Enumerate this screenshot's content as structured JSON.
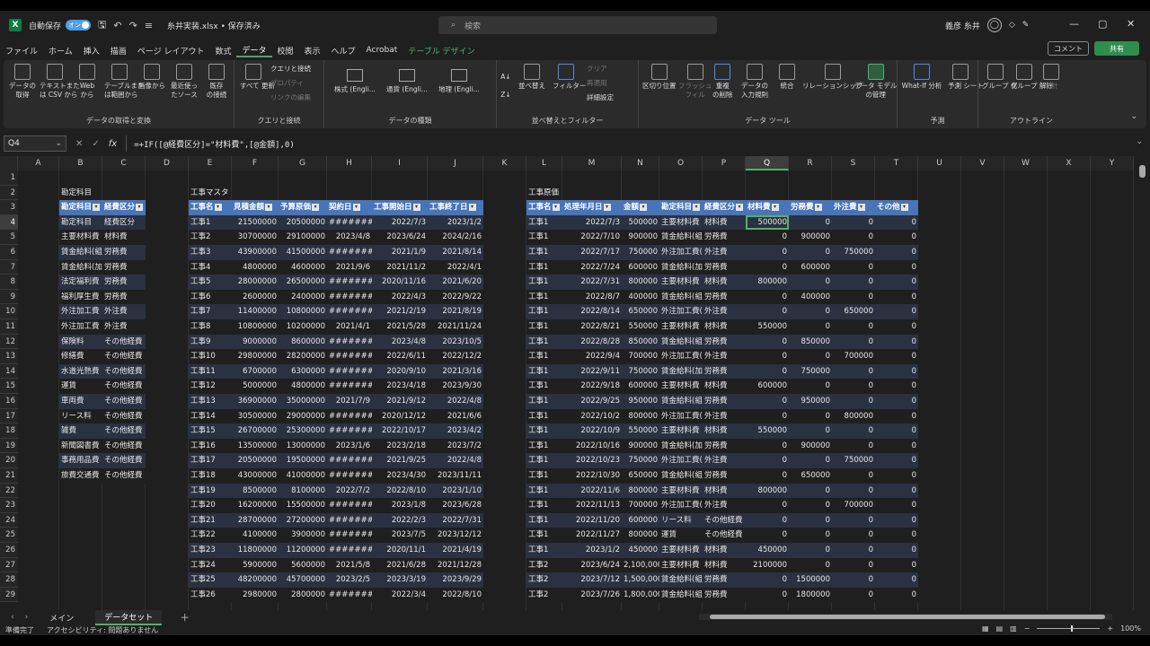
{
  "window": {
    "autosave_label": "自動保存",
    "autosave_state": "オン",
    "filename": "糸井実装.xlsx • 保存済み",
    "search_placeholder": "検索",
    "user_name": "義彦 糸井"
  },
  "menu": [
    "ファイル",
    "ホーム",
    "挿入",
    "描画",
    "ページ レイアウト",
    "数式",
    "データ",
    "校閲",
    "表示",
    "ヘルプ",
    "Acrobat",
    "テーブル デザイン"
  ],
  "menu_active": "データ",
  "comment_btn": "コメント",
  "share_btn": "共有",
  "ribbon": {
    "get_data": {
      "label": "データの取得と変換",
      "buttons": [
        "データの\n取得",
        "テキストまた\nは CSV から",
        "Web\nから",
        "テーブルまた\nは範囲から",
        "画像から",
        "最近使っ\nたソース",
        "既存\nの接続"
      ]
    },
    "queries": {
      "label": "クエリと接続",
      "refresh": "すべて\n更新",
      "items": [
        "クエリと接続",
        "プロパティ",
        "リンクの編集"
      ]
    },
    "data_types": {
      "label": "データの種類",
      "items": [
        "株式 (Engli...",
        "通貨 (Engli...",
        "地理 (Engli..."
      ]
    },
    "sort_filter": {
      "label": "並べ替えとフィルター",
      "sort": "並べ替え",
      "filter": "フィルター",
      "items": [
        "クリア",
        "再適用",
        "詳細設定"
      ]
    },
    "data_tools": {
      "label": "データ ツール",
      "buttons": [
        "区切り位置",
        "フラッシュ\nフィル",
        "重複\nの削除",
        "データの\n入力規則",
        "統合",
        "リレーションシップ",
        "データ モデル\nの管理"
      ]
    },
    "forecast": {
      "label": "予測",
      "buttons": [
        "What-If 分析",
        "予測\nシート"
      ]
    },
    "outline": {
      "label": "アウトライン",
      "buttons": [
        "グループ\n化",
        "グループ\n解除",
        "小計"
      ]
    }
  },
  "namebox": "Q4",
  "formula": "=+IF([@経費区分]=\"材料費\",[@金額],0)",
  "columns": [
    "A",
    "B",
    "C",
    "D",
    "E",
    "F",
    "G",
    "H",
    "I",
    "J",
    "K",
    "L",
    "M",
    "N",
    "O",
    "P",
    "Q",
    "R",
    "S",
    "T",
    "U",
    "V",
    "W",
    "X",
    "Y"
  ],
  "selected_column": "Q",
  "rows": [
    "1",
    "2",
    "3",
    "4",
    "5",
    "6",
    "7",
    "8",
    "9",
    "10",
    "11",
    "12",
    "13",
    "14",
    "15",
    "16",
    "17",
    "18",
    "19",
    "20",
    "21",
    "22",
    "23",
    "24",
    "25",
    "26",
    "27",
    "28",
    "29"
  ],
  "selected_row": "4",
  "table1": {
    "title": "勘定科目",
    "headers": [
      "勘定科目",
      "経費区分"
    ],
    "rows": [
      [
        "勘定科目",
        "経費区分"
      ],
      [
        "主要材料費",
        "材料費"
      ],
      [
        "賃金給料(組",
        "労務費"
      ],
      [
        "賃金給料(加",
        "労務費"
      ],
      [
        "法定福利費",
        "労務費"
      ],
      [
        "福利厚生費",
        "労務費"
      ],
      [
        "外注加工費",
        "外注費"
      ],
      [
        "外注加工費",
        "外注費"
      ],
      [
        "保険料",
        "その他経費"
      ],
      [
        "修繕費",
        "その他経費"
      ],
      [
        "水道光熱費",
        "その他経費"
      ],
      [
        "運賃",
        "その他経費"
      ],
      [
        "車両費",
        "その他経費"
      ],
      [
        "リース料",
        "その他経費"
      ],
      [
        "雑費",
        "その他経費"
      ],
      [
        "新聞図書費",
        "その他経費"
      ],
      [
        "事務用品費",
        "その他経費"
      ],
      [
        "旅費交通費",
        "その他経費"
      ]
    ]
  },
  "table2": {
    "title": "工事マスタ",
    "headers": [
      "工事名",
      "見積金額",
      "予算原価",
      "契約日",
      "工事開始日",
      "工事終了日"
    ],
    "rows": [
      [
        "工事1",
        "21500000",
        "20500000",
        "#######",
        "2022/7/3",
        "2023/1/2"
      ],
      [
        "工事2",
        "30700000",
        "29100000",
        "2023/4/8",
        "2023/6/24",
        "2024/2/16"
      ],
      [
        "工事3",
        "43900000",
        "41500000",
        "#######",
        "2021/1/9",
        "2021/8/14"
      ],
      [
        "工事4",
        "4800000",
        "4600000",
        "2021/9/6",
        "2021/11/2",
        "2022/4/1"
      ],
      [
        "工事5",
        "28000000",
        "26500000",
        "#######",
        "2020/11/16",
        "2021/6/20"
      ],
      [
        "工事6",
        "2600000",
        "2400000",
        "#######",
        "2022/4/3",
        "2022/9/22"
      ],
      [
        "工事7",
        "11400000",
        "10800000",
        "#######",
        "2021/2/19",
        "2021/8/19"
      ],
      [
        "工事8",
        "10800000",
        "10200000",
        "2021/4/1",
        "2021/5/28",
        "2021/11/24"
      ],
      [
        "工事9",
        "9000000",
        "8600000",
        "#######",
        "2023/4/8",
        "2023/10/5"
      ],
      [
        "工事10",
        "29800000",
        "28200000",
        "#######",
        "2022/6/11",
        "2022/12/2"
      ],
      [
        "工事11",
        "6700000",
        "6300000",
        "#######",
        "2020/9/10",
        "2021/3/16"
      ],
      [
        "工事12",
        "5000000",
        "4800000",
        "#######",
        "2023/4/18",
        "2023/9/30"
      ],
      [
        "工事13",
        "36900000",
        "35000000",
        "2021/7/9",
        "2021/9/12",
        "2022/4/8"
      ],
      [
        "工事14",
        "30500000",
        "29000000",
        "#######",
        "2020/12/12",
        "2021/6/6"
      ],
      [
        "工事15",
        "26700000",
        "25300000",
        "#######",
        "2022/10/17",
        "2023/4/2"
      ],
      [
        "工事16",
        "13500000",
        "13000000",
        "2023/1/6",
        "2023/2/18",
        "2023/7/2"
      ],
      [
        "工事17",
        "20500000",
        "19500000",
        "#######",
        "2021/9/25",
        "2022/4/8"
      ],
      [
        "工事18",
        "43000000",
        "41000000",
        "#######",
        "2023/4/30",
        "2023/11/11"
      ],
      [
        "工事19",
        "8500000",
        "8100000",
        "2022/7/2",
        "2022/8/10",
        "2023/1/10"
      ],
      [
        "工事20",
        "16200000",
        "15500000",
        "#######",
        "2023/1/8",
        "2023/6/28"
      ],
      [
        "工事21",
        "28700000",
        "27200000",
        "#######",
        "2022/2/3",
        "2022/7/31"
      ],
      [
        "工事22",
        "4100000",
        "3900000",
        "#######",
        "2023/7/5",
        "2023/12/12"
      ],
      [
        "工事23",
        "11800000",
        "11200000",
        "#######",
        "2020/11/1",
        "2021/4/19"
      ],
      [
        "工事24",
        "5900000",
        "5600000",
        "2021/5/8",
        "2021/6/28",
        "2021/12/28"
      ],
      [
        "工事25",
        "48200000",
        "45700000",
        "2023/2/5",
        "2023/3/19",
        "2023/9/29"
      ],
      [
        "工事26",
        "2980000",
        "2800000",
        "#######",
        "2022/3/4",
        "2022/8/10"
      ]
    ]
  },
  "table3": {
    "title": "工事原価",
    "headers": [
      "工事名",
      "処理年月日",
      "金額",
      "勘定科目",
      "経費区分",
      "材料費",
      "労務費",
      "外注費",
      "その他"
    ],
    "rows": [
      [
        "工事1",
        "2022/7/3",
        "500000",
        "主要材料費",
        "材料費",
        "500000",
        "0",
        "0",
        "0"
      ],
      [
        "工事1",
        "2022/7/10",
        "900000",
        "賃金給料(組",
        "労務費",
        "0",
        "900000",
        "0",
        "0"
      ],
      [
        "工事1",
        "2022/7/17",
        "750000",
        "外注加工費(",
        "外注費",
        "0",
        "0",
        "750000",
        "0"
      ],
      [
        "工事1",
        "2022/7/24",
        "600000",
        "賃金給料(加",
        "労務費",
        "0",
        "600000",
        "0",
        "0"
      ],
      [
        "工事1",
        "2022/7/31",
        "800000",
        "主要材料費",
        "材料費",
        "800000",
        "0",
        "0",
        "0"
      ],
      [
        "工事1",
        "2022/8/7",
        "400000",
        "賃金給料(組",
        "労務費",
        "0",
        "400000",
        "0",
        "0"
      ],
      [
        "工事1",
        "2022/8/14",
        "650000",
        "外注加工費(",
        "外注費",
        "0",
        "0",
        "650000",
        "0"
      ],
      [
        "工事1",
        "2022/8/21",
        "550000",
        "主要材料費",
        "材料費",
        "550000",
        "0",
        "0",
        "0"
      ],
      [
        "工事1",
        "2022/8/28",
        "850000",
        "賃金給料(組",
        "労務費",
        "0",
        "850000",
        "0",
        "0"
      ],
      [
        "工事1",
        "2022/9/4",
        "700000",
        "外注加工費(",
        "外注費",
        "0",
        "0",
        "700000",
        "0"
      ],
      [
        "工事1",
        "2022/9/11",
        "750000",
        "賃金給料(加",
        "労務費",
        "0",
        "750000",
        "0",
        "0"
      ],
      [
        "工事1",
        "2022/9/18",
        "600000",
        "主要材料費",
        "材料費",
        "600000",
        "0",
        "0",
        "0"
      ],
      [
        "工事1",
        "2022/9/25",
        "950000",
        "賃金給料(組",
        "労務費",
        "0",
        "950000",
        "0",
        "0"
      ],
      [
        "工事1",
        "2022/10/2",
        "800000",
        "外注加工費(",
        "外注費",
        "0",
        "0",
        "800000",
        "0"
      ],
      [
        "工事1",
        "2022/10/9",
        "550000",
        "主要材料費",
        "材料費",
        "550000",
        "0",
        "0",
        "0"
      ],
      [
        "工事1",
        "2022/10/16",
        "900000",
        "賃金給料(加",
        "労務費",
        "0",
        "900000",
        "0",
        "0"
      ],
      [
        "工事1",
        "2022/10/23",
        "750000",
        "外注加工費(",
        "外注費",
        "0",
        "0",
        "750000",
        "0"
      ],
      [
        "工事1",
        "2022/10/30",
        "650000",
        "賃金給料(組",
        "労務費",
        "0",
        "650000",
        "0",
        "0"
      ],
      [
        "工事1",
        "2022/11/6",
        "800000",
        "主要材料費",
        "材料費",
        "800000",
        "0",
        "0",
        "0"
      ],
      [
        "工事1",
        "2022/11/13",
        "700000",
        "外注加工費(",
        "外注費",
        "0",
        "0",
        "700000",
        "0"
      ],
      [
        "工事1",
        "2022/11/20",
        "600000",
        "リース料",
        "その他経費",
        "0",
        "0",
        "0",
        "0"
      ],
      [
        "工事1",
        "2022/11/27",
        "800000",
        "運賃",
        "その他経費",
        "0",
        "0",
        "0",
        "0"
      ],
      [
        "工事1",
        "2023/1/2",
        "450000",
        "主要材料費",
        "材料費",
        "450000",
        "0",
        "0",
        "0"
      ],
      [
        "工事2",
        "2023/6/24",
        "2,100,000",
        "主要材料費",
        "材料費",
        "2100000",
        "0",
        "0",
        "0"
      ],
      [
        "工事2",
        "2023/7/12",
        "1,500,000",
        "賃金給料(組",
        "労務費",
        "0",
        "1500000",
        "0",
        "0"
      ],
      [
        "工事2",
        "2023/7/26",
        "1,800,000",
        "賃金給料(組",
        "労務費",
        "0",
        "1800000",
        "0",
        "0"
      ]
    ]
  },
  "sheets": [
    "メイン",
    "データセット"
  ],
  "active_sheet": "データセット",
  "status": {
    "ready": "準備完了",
    "accessibility": "アクセシビリティ: 問題ありません",
    "zoom": "100%"
  }
}
